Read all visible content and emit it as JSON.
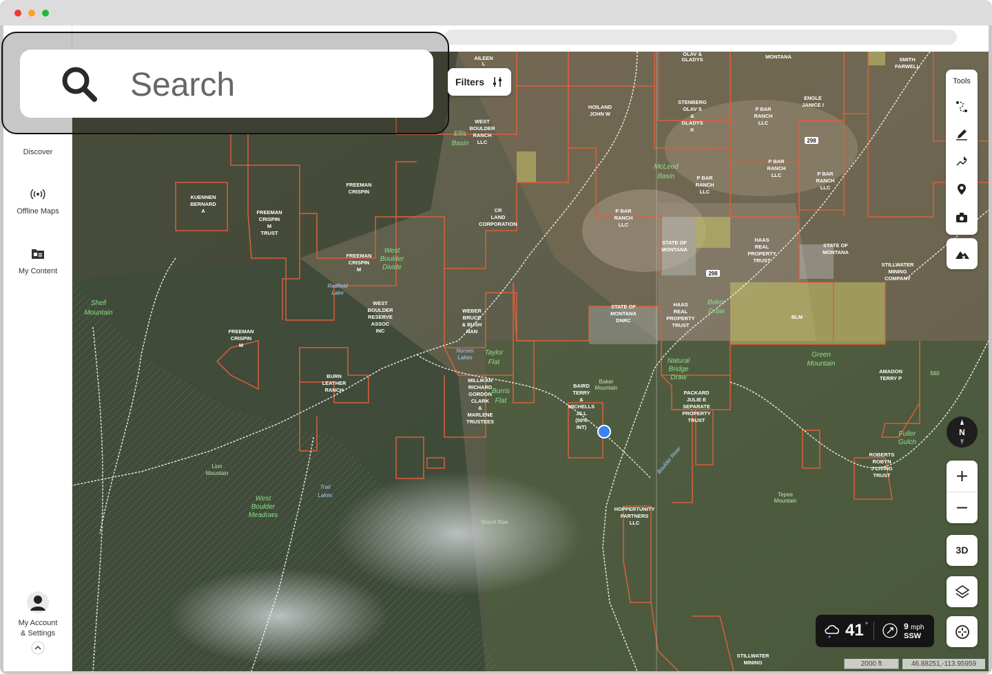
{
  "search": {
    "placeholder": "Search"
  },
  "filters": {
    "label": "Filters"
  },
  "sidebar": {
    "items": [
      {
        "label": "Discover",
        "icon": "compass-icon"
      },
      {
        "label": "Offline Maps",
        "icon": "broadcast-icon"
      },
      {
        "label": "My Content",
        "icon": "folder-icon"
      }
    ],
    "account": {
      "label_line1": "My Account",
      "label_line2": "& Settings",
      "icon": "avatar-icon"
    }
  },
  "tools": {
    "label": "Tools"
  },
  "map_controls": {
    "compass": "N",
    "btn3d": "3D"
  },
  "weather": {
    "temp": "41",
    "deg": "°",
    "wind_speed": "9",
    "wind_unit": "mph",
    "wind_dir": "SSW"
  },
  "scale": "2000 ft",
  "coordinates": "46.88251,-113.95959",
  "colors": {
    "boundary": "#d9603b",
    "public_land": "#c9c467",
    "accent_dot": "#3b82f6",
    "trail": "#ffffff"
  },
  "map_labels": {
    "owners": [
      "AILEEN L",
      "OLAV & GLADYS",
      "MONTANA",
      "SMITH FARWELL",
      "HOILAND JOHN W",
      "STENBERG OLAV S & GLADYS K",
      "P BAR RANCH LLC",
      "ENGLE JANICE I",
      "WEST BOULDER RANCH LLC",
      "P BAR RANCH LLC",
      "P BAR RANCH LLC",
      "KUENNEN BERNARD A",
      "FREEMAN CRISPIN",
      "FREEMAN CRISPIN M TRUST",
      "CR LAND CORPORATION",
      "P BAR RANCH LLC",
      "FREEMAN CRISPIN M",
      "STATE OF MONTANA",
      "HAAS REAL PROPERTY TRUST",
      "STATE OF MONTANA",
      "STILLWATER MINING COMPANY",
      "WEST BOULDER RESERVE ASSOC INC",
      "WEBER BRUCE & BUSH NAN",
      "STATE OF MONTANA DNRC",
      "HAAS REAL PROPERTY TRUST",
      "BLM",
      "FREEMAN CRISPIN M",
      "BURN LEATHER RANCH",
      "MILLIKAN RICHARD GORDON CLARK & MARLENE TRUSTEES",
      "BAIRD TERRY & MICHELLS JILL (50% INT)",
      "PACKARD JULIE E SEPARATE PROPERTY TRUST",
      "AMADON TERRY P",
      "ROBERTS ROBYN J LIVING TRUST",
      "HOPPERTUNITY PARTNERS LLC",
      "STILLWATER MINING"
    ],
    "natural": [
      "Ellis Basin",
      "McLeod Basin",
      "West Boulder Divide",
      "Shell Mountain",
      "Taylor Flat",
      "Burris Flat",
      "Green Mountain",
      "Natural Bridge Draw",
      "Baker Draw",
      "Lion Mountain",
      "West Boulder Meadows",
      "Fuller Gulch"
    ],
    "water": [
      "Redfield Lake",
      "Nurses Lakes",
      "Boulder River",
      "Trail Lakes"
    ],
    "peaks": [
      "Baker Mountain",
      "Tepee Mountain",
      "Mount Rae",
      "560"
    ],
    "roads": [
      "298",
      "298"
    ]
  }
}
